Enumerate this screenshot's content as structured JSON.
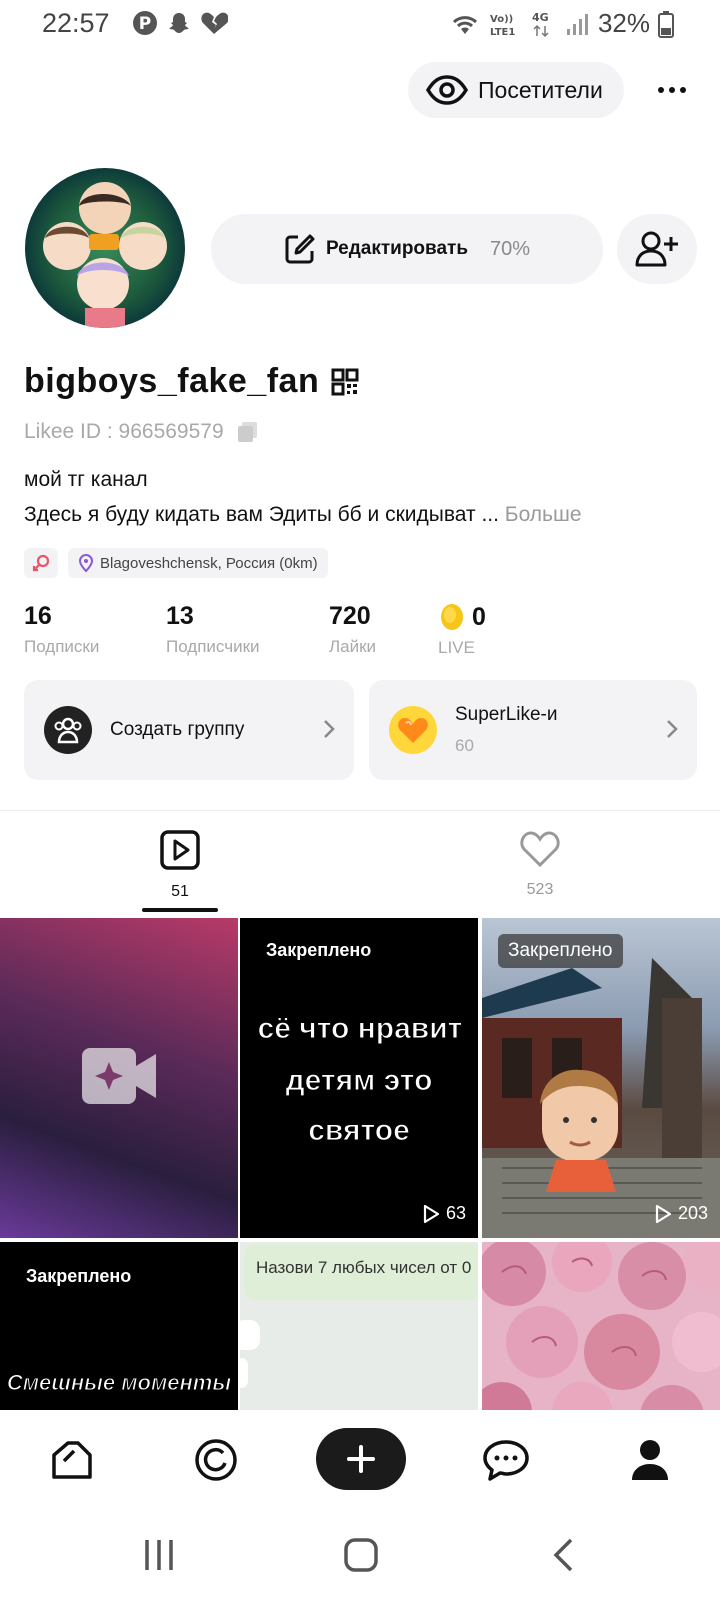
{
  "status_bar": {
    "time": "22:57",
    "battery": "32%",
    "network": "4G",
    "volte": "Vo)) LTE1"
  },
  "header": {
    "visitors_label": "Посетители"
  },
  "profile": {
    "edit_label": "Редактировать",
    "edit_progress": "70%",
    "username": "bigboys_fake_fan",
    "likee_id": "Likee ID : 966569579",
    "bio_line1": "мой тг канал",
    "bio_line2": "Здесь я буду кидать вам Эдиты бб и скидыват ...",
    "bio_more": "Больше",
    "location": "Blagoveshchensk, Россия (0km)"
  },
  "stats": [
    {
      "value": "16",
      "label": "Подписки"
    },
    {
      "value": "13",
      "label": "Подписчики"
    },
    {
      "value": "720",
      "label": "Лайки"
    },
    {
      "value": "0",
      "label": "LIVE"
    }
  ],
  "cards": {
    "group_label": "Создать группу",
    "superlike_label": "SuperLike-и",
    "superlike_count": "60"
  },
  "tabs": {
    "videos_count": "51",
    "likes_count": "523"
  },
  "grid": {
    "pinned_label": "Закреплено",
    "tile2_text_line1": "сё что нравит",
    "tile2_text_line2": "детям это",
    "tile2_text_line3": "святое",
    "tile2_views": "63",
    "tile3_views": "203",
    "tile4_text": "Смешные моменты",
    "tile5_text": "Назови 7 любых чисел от 0"
  },
  "colors": {
    "accent": "#1b1b1b",
    "pill_bg": "#f3f3f5",
    "muted": "#a9a9a9",
    "coin": "#f5c518"
  }
}
